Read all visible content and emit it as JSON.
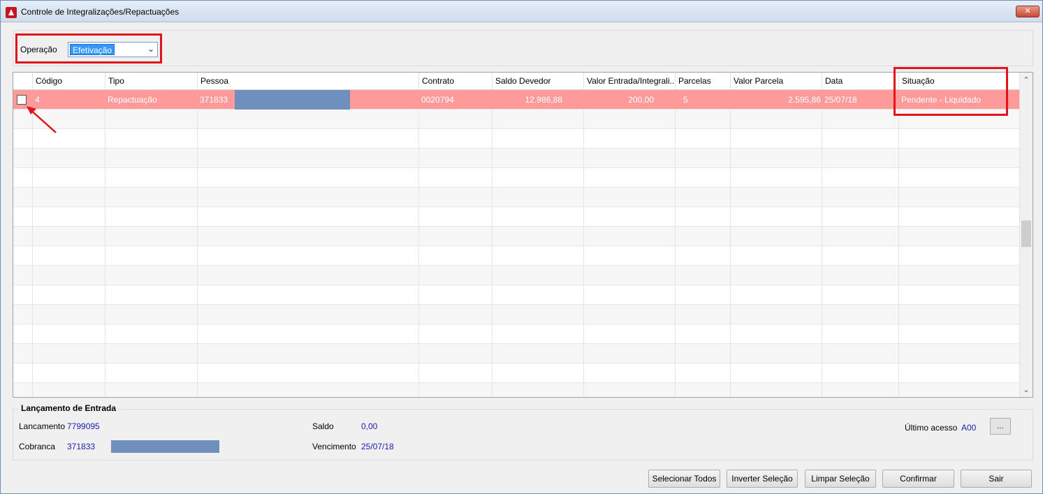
{
  "window": {
    "title": "Controle de Integralizações/Repactuações",
    "close_label": "✕"
  },
  "operation": {
    "label": "Operação",
    "selected": "Efetivação"
  },
  "grid": {
    "columns": [
      "Código",
      "Tipo",
      "Pessoa",
      "Contrato",
      "Saldo Devedor",
      "Valor Entrada/Integrali...",
      "Parcelas",
      "Valor Parcela",
      "Data",
      "Situação"
    ],
    "rows": [
      {
        "checked": false,
        "codigo": "4",
        "tipo": "Repactuação",
        "pessoa": "371833",
        "contrato": "0020794",
        "saldo_devedor": "12.986,88",
        "valor_entrada": "200,00",
        "parcelas": "5",
        "valor_parcela": "2.595,86",
        "data": "25/07/18",
        "situacao": "Pendente - Liquidado"
      }
    ]
  },
  "entry": {
    "title": "Lançamento de Entrada",
    "lancamento_label": "Lancamento",
    "lancamento_value": "7799095",
    "cobranca_label": "Cobranca",
    "cobranca_value": "371833",
    "saldo_label": "Saldo",
    "saldo_value": "0,00",
    "vencimento_label": "Vencimento",
    "vencimento_value": "25/07/18",
    "ultimo_acesso_label": "Último acesso",
    "ultimo_acesso_value": "A00",
    "more_label": "..."
  },
  "buttons": {
    "select_all": "Selecionar Todos",
    "invert": "Inverter Seleção",
    "clear": "Limpar Seleção",
    "confirm": "Confirmar",
    "exit": "Sair"
  },
  "colors": {
    "selected_row": "#ff9a9a",
    "highlight": "#e2131d",
    "value_text": "#1b1bb0"
  }
}
